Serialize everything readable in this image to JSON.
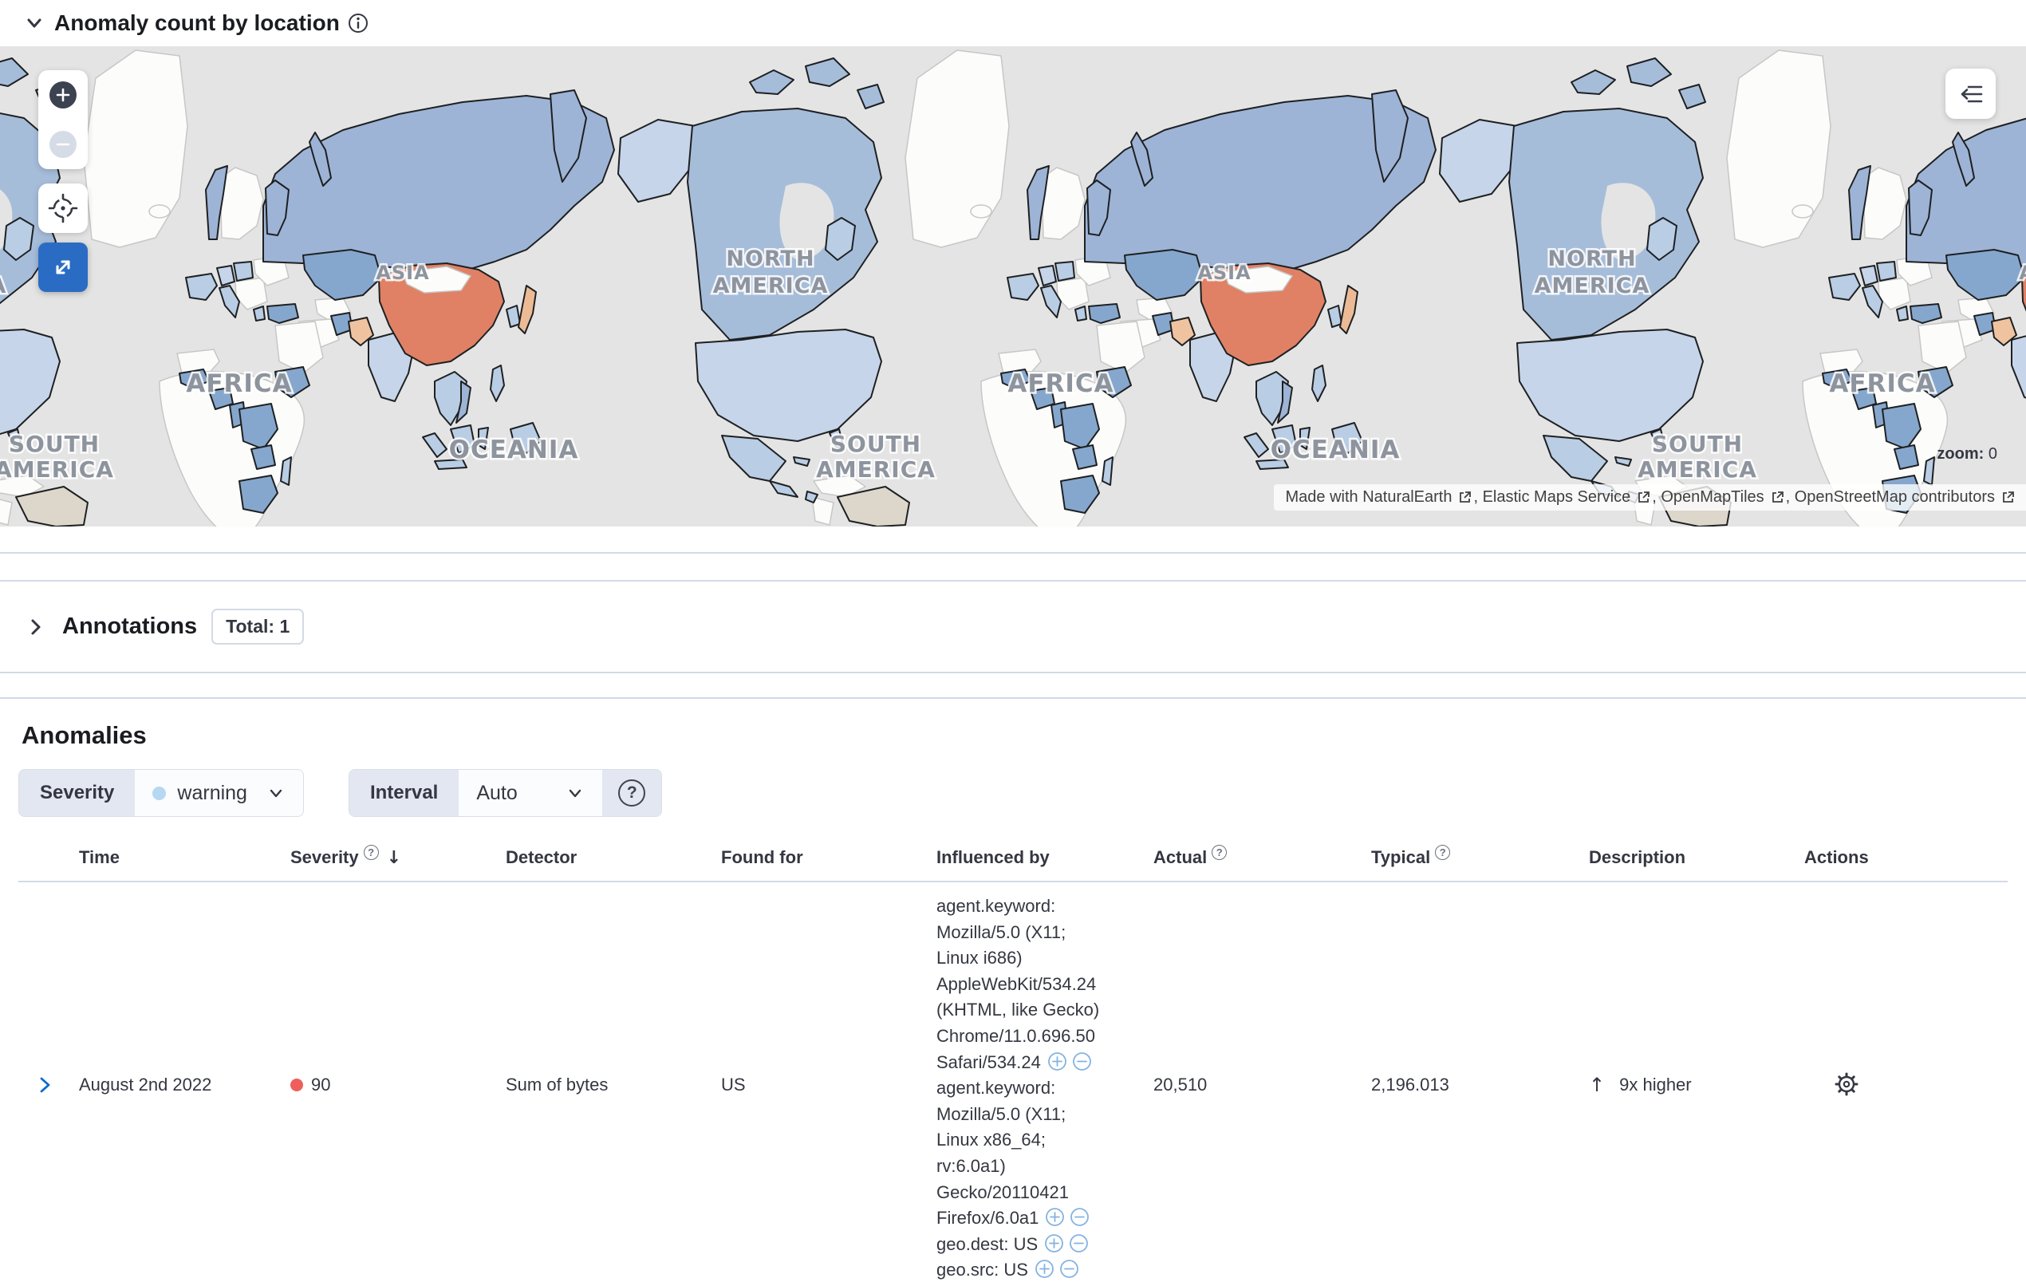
{
  "map_section": {
    "title": "Anomaly count by location",
    "zoom_label": "zoom:",
    "zoom_value": "0",
    "attribution": [
      "Made with NaturalEarth",
      ", Elastic Maps Service",
      ", OpenMapTiles",
      ", OpenStreetMap contributors"
    ],
    "region_labels": {
      "asia": "ASIA",
      "north_america": [
        "NORTH",
        "AMERICA"
      ],
      "africa": "AFRICA",
      "oceania": "OCEANIA",
      "south_america": [
        "SOUTH",
        "AMERICA"
      ]
    },
    "colors": {
      "ocean": "#e4e4e4",
      "no_data_land": "#fcfcfa",
      "border": "#1e2022",
      "blue_medium": "#9db4d6",
      "blue_dark": "#86a7cd",
      "blue_light": "#c6d5e9",
      "blue_canada": "#a6bdda",
      "salmon_high": "#e08165",
      "salmon_low": "#f0c3a0",
      "gray_land": "#ddd7cb"
    }
  },
  "annotations_section": {
    "title": "Annotations",
    "badge": "Total: 1"
  },
  "anomalies_section": {
    "title": "Anomalies",
    "filters": {
      "severity_label": "Severity",
      "severity_value": "warning",
      "severity_dot_color": "#b6d8f0",
      "interval_label": "Interval",
      "interval_value": "Auto"
    },
    "table": {
      "columns": [
        "Time",
        "Severity",
        "Detector",
        "Found for",
        "Influenced by",
        "Actual",
        "Typical",
        "Description",
        "Actions"
      ],
      "sort_arrow": "↓",
      "rows": [
        {
          "time": "August 2nd 2022",
          "severity": "90",
          "severity_color": "#ee5f5b",
          "detector": "Sum of bytes",
          "found_for": "US",
          "influenced_by": [
            {
              "lines": [
                "agent.keyword:",
                "Mozilla/5.0 (X11;",
                "Linux i686)",
                "AppleWebKit/534.24",
                "(KHTML, like Gecko)",
                "Chrome/11.0.696.50",
                "Safari/534.24"
              ]
            },
            {
              "lines": [
                "agent.keyword:",
                "Mozilla/5.0 (X11;",
                "Linux x86_64;",
                "rv:6.0a1)",
                "Gecko/20110421",
                "Firefox/6.0a1"
              ]
            },
            {
              "lines": [
                "geo.dest: US"
              ]
            },
            {
              "lines": [
                "geo.src: US"
              ]
            }
          ],
          "actual": "20,510",
          "typical": "2,196.013",
          "description_arrow": "↑",
          "description": "9x higher"
        }
      ]
    }
  }
}
